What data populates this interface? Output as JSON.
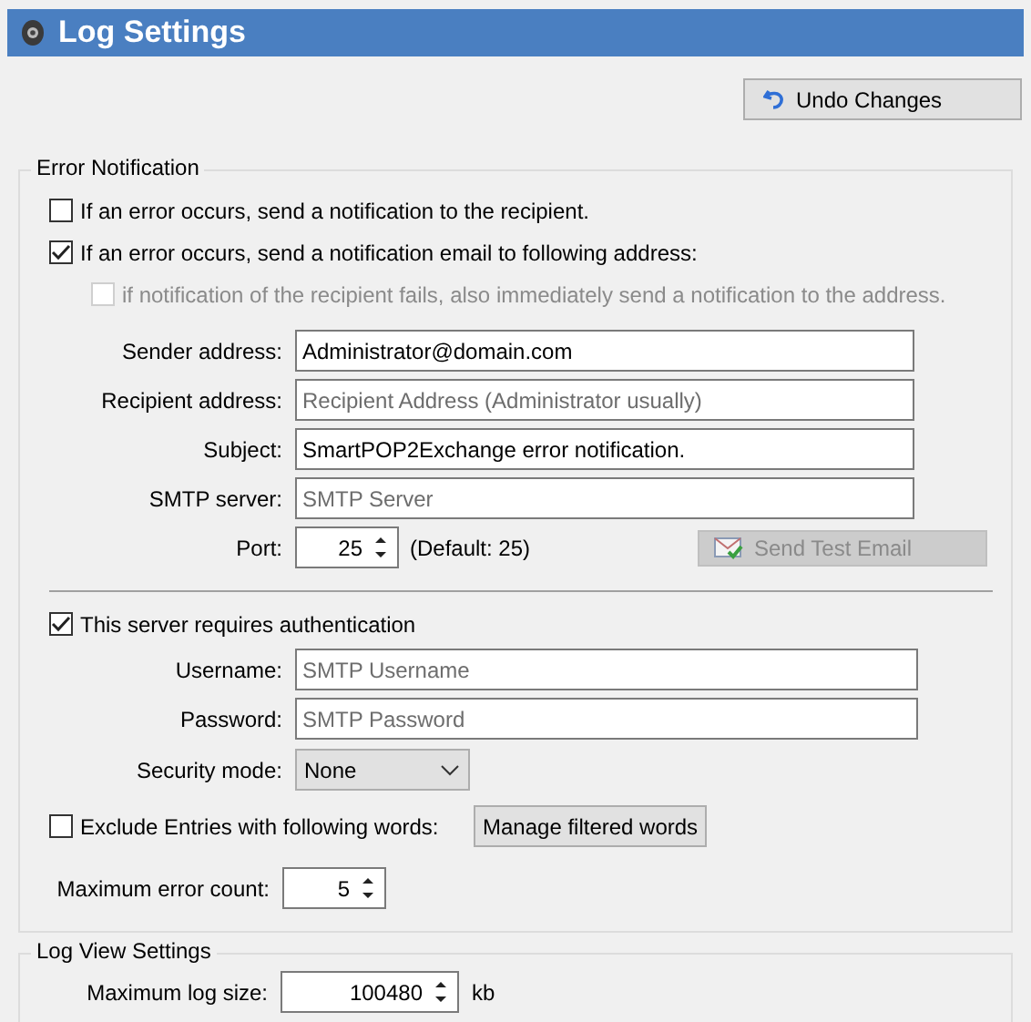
{
  "window": {
    "title": "Log Settings"
  },
  "undo_button": {
    "label": "Undo Changes"
  },
  "error_notification": {
    "title": "Error Notification",
    "options": [
      {
        "label": "If an error occurs, send a notification to the recipient.",
        "checked": false,
        "disabled": false
      },
      {
        "label": "If an error occurs, send a notification email to following address:",
        "checked": true,
        "disabled": false
      },
      {
        "label": "if notification of the recipient fails, also immediately send a notification to the address.",
        "checked": false,
        "disabled": true
      }
    ],
    "fields": [
      {
        "label": "Sender address:",
        "value": "Administrator@domain.com"
      },
      {
        "label": "Recipient address:",
        "placeholder": "Recipient Address (Administrator usually)"
      },
      {
        "label": "Subject:",
        "value": "SmartPOP2Exchange error notification."
      },
      {
        "label": "SMTP server:",
        "placeholder": "SMTP Server"
      }
    ],
    "port": {
      "label": "Port:",
      "value": "25",
      "hint": "(Default: 25)"
    },
    "test_button": {
      "label": "Send Test Email",
      "disabled": true
    },
    "auth": {
      "label": "This server requires authentication",
      "checked": true
    },
    "auth_fields": [
      {
        "label": "Username:",
        "placeholder": "SMTP Username"
      },
      {
        "label": "Password:",
        "placeholder": "SMTP Password"
      }
    ],
    "security_mode": {
      "label": "Security mode:",
      "value": "None"
    },
    "exclude": {
      "label": "Exclude Entries with following words:",
      "checked": false
    },
    "manage_button": {
      "label": "Manage filtered words"
    },
    "max_errors": {
      "label": "Maximum error count:",
      "value": "5"
    }
  },
  "log_view": {
    "title": "Log View Settings",
    "max_size": {
      "label": "Maximum log size:",
      "value": "100480",
      "unit": "kb"
    }
  }
}
